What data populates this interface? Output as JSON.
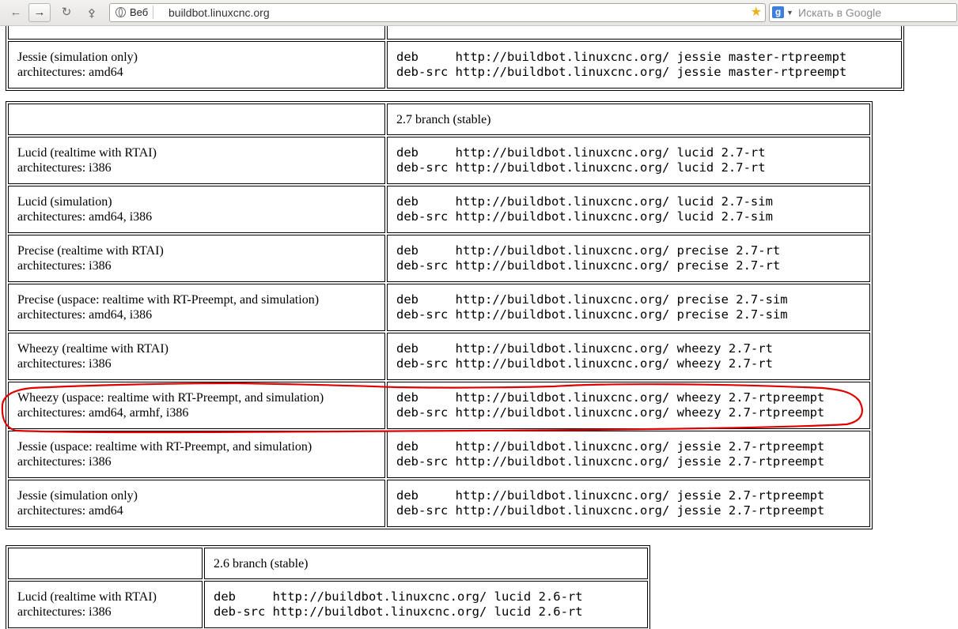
{
  "browser": {
    "site_label": "Веб",
    "url": "buildbot.linuxcnc.org",
    "search_placeholder": "Искать в Google",
    "search_engine_icon": "g"
  },
  "tables": {
    "master_tail": {
      "rows": [
        {
          "dist": "Jessie (simulation only)",
          "arch": "architectures: amd64",
          "deb": "deb     http://buildbot.linuxcnc.org/ jessie master-rtpreempt",
          "debsrc": "deb-src http://buildbot.linuxcnc.org/ jessie master-rtpreempt"
        }
      ]
    },
    "branch27": {
      "header": "2.7 branch (stable)",
      "rows": [
        {
          "dist": "Lucid (realtime with RTAI)",
          "arch": "architectures: i386",
          "deb": "deb     http://buildbot.linuxcnc.org/ lucid 2.7-rt",
          "debsrc": "deb-src http://buildbot.linuxcnc.org/ lucid 2.7-rt"
        },
        {
          "dist": "Lucid (simulation)",
          "arch": "architectures: amd64, i386",
          "deb": "deb     http://buildbot.linuxcnc.org/ lucid 2.7-sim",
          "debsrc": "deb-src http://buildbot.linuxcnc.org/ lucid 2.7-sim"
        },
        {
          "dist": "Precise (realtime with RTAI)",
          "arch": "architectures: i386",
          "deb": "deb     http://buildbot.linuxcnc.org/ precise 2.7-rt",
          "debsrc": "deb-src http://buildbot.linuxcnc.org/ precise 2.7-rt"
        },
        {
          "dist": "Precise (uspace: realtime with RT-Preempt, and simulation)",
          "arch": "architectures: amd64, i386",
          "deb": "deb     http://buildbot.linuxcnc.org/ precise 2.7-sim",
          "debsrc": "deb-src http://buildbot.linuxcnc.org/ precise 2.7-sim"
        },
        {
          "dist": "Wheezy (realtime with RTAI)",
          "arch": "architectures: i386",
          "deb": "deb     http://buildbot.linuxcnc.org/ wheezy 2.7-rt",
          "debsrc": "deb-src http://buildbot.linuxcnc.org/ wheezy 2.7-rt"
        },
        {
          "dist": "Wheezy (uspace: realtime with RT-Preempt, and simulation)",
          "arch": "architectures: amd64, armhf, i386",
          "deb": "deb     http://buildbot.linuxcnc.org/ wheezy 2.7-rtpreempt",
          "debsrc": "deb-src http://buildbot.linuxcnc.org/ wheezy 2.7-rtpreempt"
        },
        {
          "dist": "Jessie (uspace: realtime with RT-Preempt, and simulation)",
          "arch": "architectures: i386",
          "deb": "deb     http://buildbot.linuxcnc.org/ jessie 2.7-rtpreempt",
          "debsrc": "deb-src http://buildbot.linuxcnc.org/ jessie 2.7-rtpreempt"
        },
        {
          "dist": "Jessie (simulation only)",
          "arch": "architectures: amd64",
          "deb": "deb     http://buildbot.linuxcnc.org/ jessie 2.7-rtpreempt",
          "debsrc": "deb-src http://buildbot.linuxcnc.org/ jessie 2.7-rtpreempt"
        }
      ]
    },
    "branch26": {
      "header": "2.6 branch (stable)",
      "rows": [
        {
          "dist": "Lucid (realtime with RTAI)",
          "arch": "architectures: i386",
          "deb": "deb     http://buildbot.linuxcnc.org/ lucid 2.6-rt",
          "debsrc": "deb-src http://buildbot.linuxcnc.org/ lucid 2.6-rt"
        }
      ]
    }
  },
  "annotation": {
    "color": "#e00000"
  }
}
